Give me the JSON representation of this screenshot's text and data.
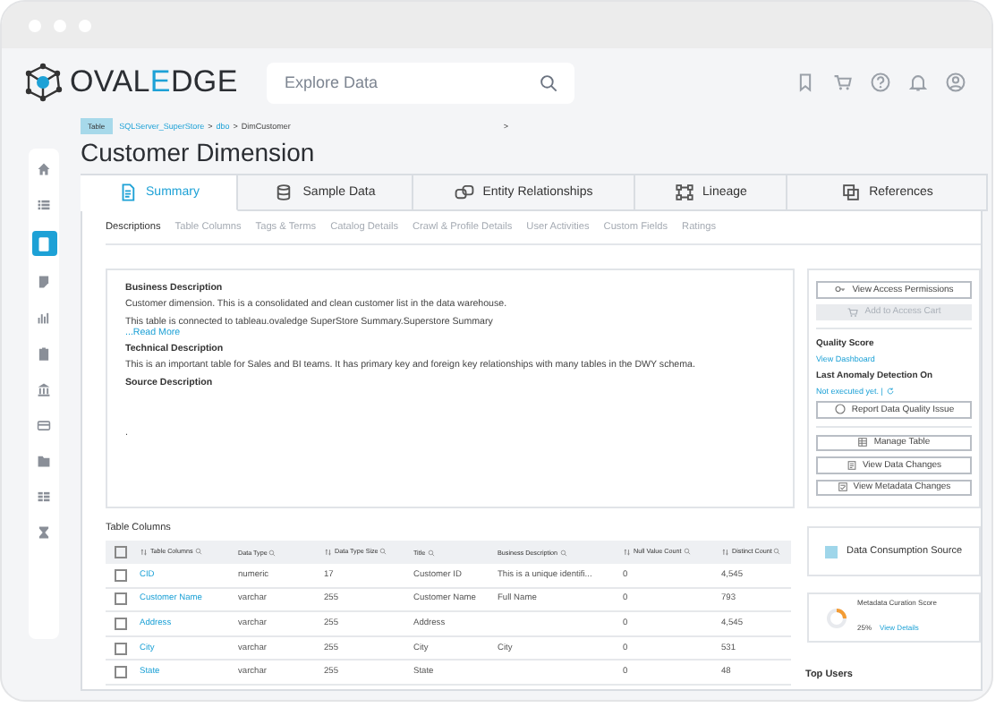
{
  "header": {
    "logo": "OVAL**E**DGE",
    "search": {
      "placeholder": "Explore Data"
    },
    "icons": [
      {
        "kind": "bookmark"
      },
      {
        "kind": "cart"
      },
      {
        "kind": "help"
      },
      {
        "kind": "bell"
      },
      {
        "kind": "user"
      }
    ]
  },
  "sidebar": {
    "items": [
      {
        "kind": "home",
        "selected": false
      },
      {
        "kind": "list",
        "selected": false
      },
      {
        "kind": "document",
        "selected": true
      },
      {
        "kind": "note",
        "selected": false
      },
      {
        "kind": "chart",
        "selected": false
      },
      {
        "kind": "clipboard",
        "selected": false
      },
      {
        "kind": "bank",
        "selected": false
      },
      {
        "kind": "card",
        "selected": false
      },
      {
        "kind": "folder",
        "selected": false
      },
      {
        "kind": "grid",
        "selected": false
      },
      {
        "kind": "hourglass",
        "selected": false
      }
    ]
  },
  "breadcrumb": {
    "badge": "Table",
    "path": [
      "SQLServer_SuperStore",
      "dbo",
      "DimCustomer"
    ],
    "separator": ">",
    "trailing": ">"
  },
  "title": "Customer Dimension",
  "tabs": [
    {
      "label": "Summary",
      "kind": "document",
      "selected": true
    },
    {
      "label": "Sample Data",
      "kind": "database",
      "selected": false
    },
    {
      "label": "Entity Relationships",
      "kind": "entities",
      "selected": false
    },
    {
      "label": "Lineage",
      "kind": "lineage",
      "selected": false
    },
    {
      "label": "References",
      "kind": "references",
      "selected": false
    }
  ],
  "subtabs": [
    {
      "label": "Descriptions",
      "selected": true
    },
    {
      "label": "Table Columns",
      "selected": false
    },
    {
      "label": "Tags & Terms",
      "selected": false
    },
    {
      "label": "Catalog Details",
      "selected": false
    },
    {
      "label": "Crawl & Profile Details",
      "selected": false
    },
    {
      "label": "User Activities",
      "selected": false
    },
    {
      "label": "Custom Fields",
      "selected": false
    },
    {
      "label": "Ratings",
      "selected": false
    }
  ],
  "descriptions": [
    {
      "heading": "Business Description",
      "paragraphs": [
        "Customer dimension. This is a consolidated and clean customer list in the data warehouse.",
        "This table is connected to tableau.ovaledge SuperStore Summary.Superstore Summary"
      ],
      "link": "...Read More"
    },
    {
      "heading": "Technical Description",
      "paragraphs": [
        "This is an important table for Sales and BI teams. It has primary key and foreign key relationships with many tables in the DWY schema."
      ]
    },
    {
      "heading": "Source Description",
      "paragraphs": [
        "."
      ]
    }
  ],
  "actions": {
    "view_access": "View Access Permissions",
    "add_to_cart": {
      "label": "Add to Access Cart",
      "disabled": true
    },
    "quality_label": "Quality Score",
    "quality_link": "View Dashboard",
    "anomaly_label": "Last Anomaly Detection On",
    "anomaly_value": "Not executed yet. |",
    "report": "Report Data Quality Issue",
    "buttons": [
      {
        "label": "Manage Table",
        "kind": "table"
      },
      {
        "label": "View Data Changes",
        "kind": "changes"
      },
      {
        "label": "View Metadata Changes",
        "kind": "metadata"
      }
    ]
  },
  "consumption": {
    "label": "Data Consumption Source",
    "checked": true
  },
  "curation": {
    "label": "Metadata Curation Score",
    "value": "25%",
    "link": "View Details",
    "level": 0.25
  },
  "top_users": "Top Users",
  "table": {
    "title": "Table Columns",
    "all_checked": false,
    "columns": [
      {
        "label": "Table Columns",
        "sortable": true
      },
      {
        "label": "Data Type",
        "sortable": false
      },
      {
        "label": "Data Type Size",
        "sortable": true
      },
      {
        "label": "Title",
        "sortable": false
      },
      {
        "label": "Business Description",
        "sortable": false
      },
      {
        "label": "Null Value Count",
        "sortable": true
      },
      {
        "label": "Distinct Count",
        "sortable": true
      }
    ],
    "rows": [
      {
        "checked": false,
        "cells": [
          "CID",
          "numeric",
          "17",
          "Customer ID",
          "This is a unique identifi...",
          "0",
          "4,545"
        ]
      },
      {
        "checked": false,
        "cells": [
          "Customer Name",
          "varchar",
          "255",
          "Customer Name",
          "Full Name",
          "0",
          "793"
        ]
      },
      {
        "checked": false,
        "cells": [
          "Address",
          "varchar",
          "255",
          "Address",
          "",
          "0",
          "4,545"
        ]
      },
      {
        "checked": false,
        "cells": [
          "City",
          "varchar",
          "255",
          "City",
          "City",
          "0",
          "531"
        ]
      },
      {
        "checked": false,
        "cells": [
          "State",
          "varchar",
          "255",
          "State",
          "",
          "0",
          "48"
        ]
      }
    ]
  }
}
